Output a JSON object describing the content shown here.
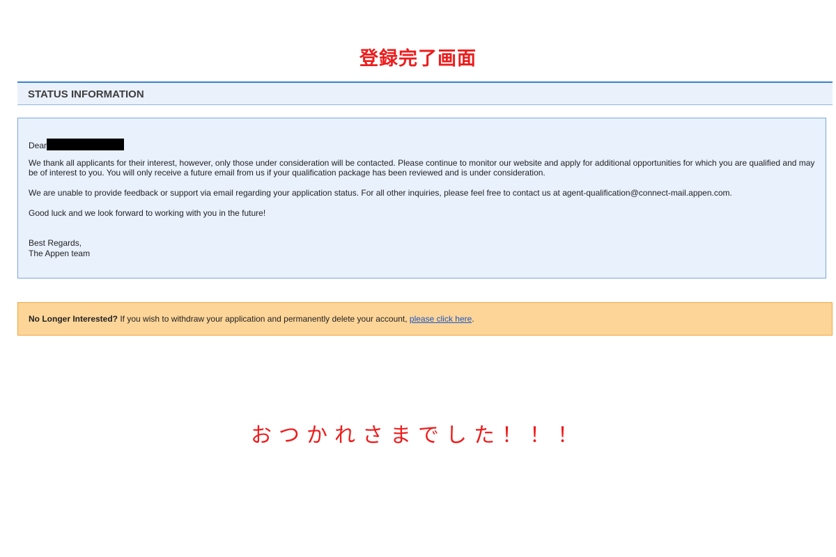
{
  "captions": {
    "top": "登録完了画面",
    "bottom": "おつかれさまでした！！！"
  },
  "status_header": {
    "title": "STATUS INFORMATION"
  },
  "status_message": {
    "greeting": "Dear",
    "paragraph1": "We thank all applicants for their interest, however, only those under consideration will be contacted. Please continue to monitor our website and apply for additional opportunities for which you are qualified and may be of interest to you. You will only receive a future email from us if your qualification package has been reviewed and is under consideration.",
    "paragraph2": "We are unable to provide feedback or support via email regarding your application status. For all other inquiries, please feel free to contact us at agent-qualification@connect-mail.appen.com.",
    "paragraph3": "Good luck and we look forward to working with you in the future!",
    "signoff1": "Best Regards,",
    "signoff2": "The Appen team"
  },
  "withdraw": {
    "heading": "No Longer Interested?",
    "text": " If you wish to withdraw your application and permanently delete your account, ",
    "link_label": "please click here",
    "end": "."
  },
  "colors": {
    "caption_red": "#ee1c1c",
    "header_border": "#3a7fd0",
    "box_background": "#e9f1fd",
    "withdraw_background": "#fdd598",
    "link": "#1a55c2"
  }
}
